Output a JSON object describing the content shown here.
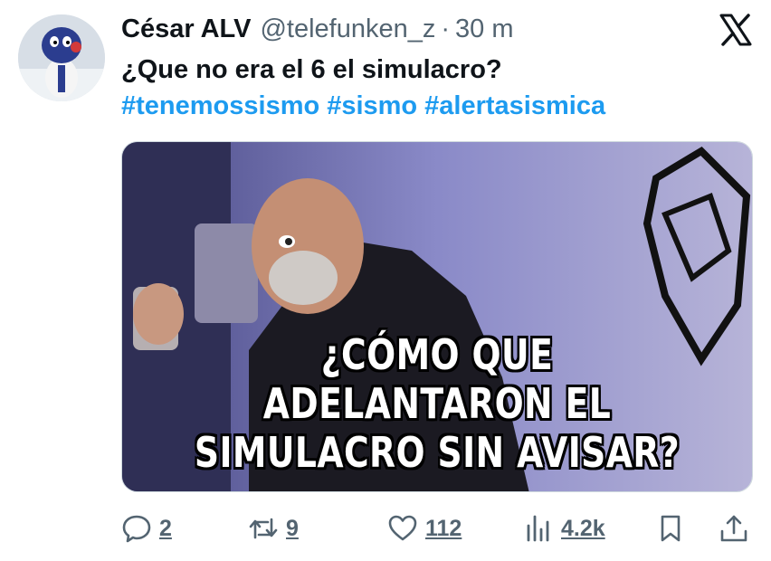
{
  "tweet": {
    "author_name": "César ALV",
    "handle": "@telefunken_z",
    "separator": "·",
    "time": "30 m",
    "text": "¿Que no era el 6 el simulacro?",
    "hashtags": [
      "#tenemossismo",
      "#sismo",
      "#alertasismica"
    ],
    "media": {
      "caption_line1": "¿CÓMO QUE ADELANTARON EL",
      "caption_line2": "SIMULACRO SIN AVISAR?"
    }
  },
  "actions": {
    "replies": "2",
    "reposts": "9",
    "likes": "112",
    "views": "4.2k"
  },
  "icons": {
    "logo": "x-logo-icon",
    "reply": "reply-icon",
    "repost": "repost-icon",
    "like": "heart-icon",
    "views": "views-icon",
    "bookmark": "bookmark-icon",
    "share": "share-icon"
  },
  "colors": {
    "link": "#1d9bf0",
    "secondary_text": "#536471",
    "primary_text": "#0f1419"
  }
}
